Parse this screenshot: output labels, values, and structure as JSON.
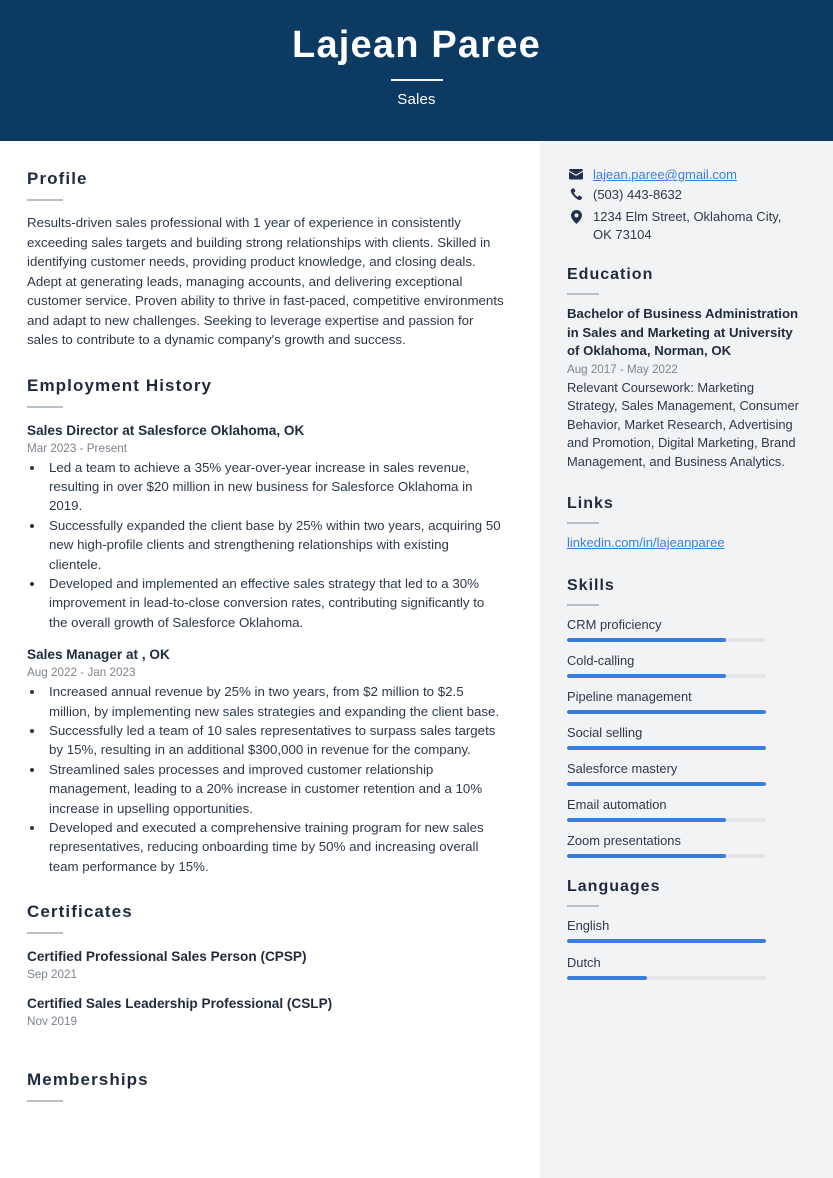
{
  "header": {
    "name": "Lajean Paree",
    "title": "Sales"
  },
  "main": {
    "profile": {
      "heading": "Profile",
      "text": "Results-driven sales professional with 1 year of experience in consistently exceeding sales targets and building strong relationships with clients. Skilled in identifying customer needs, providing product knowledge, and closing deals. Adept at generating leads, managing accounts, and delivering exceptional customer service. Proven ability to thrive in fast-paced, competitive environments and adapt to new challenges. Seeking to leverage expertise and passion for sales to contribute to a dynamic company's growth and success."
    },
    "employment": {
      "heading": "Employment History",
      "entries": [
        {
          "title": "Sales Director at Salesforce Oklahoma, OK",
          "date": "Mar 2023 - Present",
          "bullets": [
            "Led a team to achieve a 35% year-over-year increase in sales revenue, resulting in over $20 million in new business for Salesforce Oklahoma in 2019.",
            "Successfully expanded the client base by 25% within two years, acquiring 50 new high-profile clients and strengthening relationships with existing clientele.",
            "Developed and implemented an effective sales strategy that led to a 30% improvement in lead-to-close conversion rates, contributing significantly to the overall growth of Salesforce Oklahoma."
          ]
        },
        {
          "title": "Sales Manager at , OK",
          "date": "Aug 2022 - Jan 2023",
          "bullets": [
            "Increased annual revenue by 25% in two years, from $2 million to $2.5 million, by implementing new sales strategies and expanding the client base.",
            "Successfully led a team of 10 sales representatives to surpass sales targets by 15%, resulting in an additional $300,000 in revenue for the company.",
            "Streamlined sales processes and improved customer relationship management, leading to a 20% increase in customer retention and a 10% increase in upselling opportunities.",
            "Developed and executed a comprehensive training program for new sales representatives, reducing onboarding time by 50% and increasing overall team performance by 15%."
          ]
        }
      ]
    },
    "certificates": {
      "heading": "Certificates",
      "entries": [
        {
          "title": "Certified Professional Sales Person (CPSP)",
          "date": "Sep 2021"
        },
        {
          "title": "Certified Sales Leadership Professional (CSLP)",
          "date": "Nov 2019"
        }
      ]
    },
    "memberships": {
      "heading": "Memberships"
    }
  },
  "sidebar": {
    "contact": [
      {
        "icon": "email-icon",
        "value": "lajean.paree@gmail.com",
        "link": true
      },
      {
        "icon": "phone-icon",
        "value": "(503) 443-8632",
        "link": false
      },
      {
        "icon": "location-icon",
        "value": "1234 Elm Street, Oklahoma City, OK 73104",
        "link": false
      }
    ],
    "education": {
      "heading": "Education",
      "title": "Bachelor of Business Administration in Sales and Marketing at University of Oklahoma, Norman, OK",
      "date": "Aug 2017 - May 2022",
      "description": "Relevant Coursework: Marketing Strategy, Sales Management, Consumer Behavior, Market Research, Advertising and Promotion, Digital Marketing, Brand Management, and Business Analytics."
    },
    "links": {
      "heading": "Links",
      "items": [
        {
          "label": "linkedin.com/in/lajeanparee"
        }
      ]
    },
    "skills": {
      "heading": "Skills",
      "items": [
        {
          "label": "CRM proficiency",
          "level": 80
        },
        {
          "label": "Cold-calling",
          "level": 80
        },
        {
          "label": "Pipeline management",
          "level": 100
        },
        {
          "label": "Social selling",
          "level": 100
        },
        {
          "label": "Salesforce mastery",
          "level": 100
        },
        {
          "label": "Email automation",
          "level": 80
        },
        {
          "label": "Zoom presentations",
          "level": 80
        }
      ]
    },
    "languages": {
      "heading": "Languages",
      "items": [
        {
          "label": "English",
          "level": 100
        },
        {
          "label": "Dutch",
          "level": 40
        }
      ]
    }
  },
  "colors": {
    "header_bg": "#0d3a63",
    "sidebar_bg": "#f2f3f5",
    "accent": "#3b7ddd",
    "text": "#2d394b",
    "muted": "#7b848f"
  }
}
